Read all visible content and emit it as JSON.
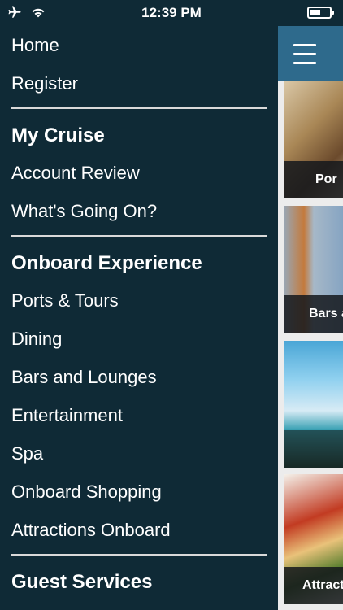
{
  "status_bar": {
    "time": "12:39 PM",
    "battery_level": 0.45
  },
  "menu": {
    "home": "Home",
    "register": "Register",
    "my_cruise": {
      "heading": "My Cruise",
      "items": [
        "Account Review",
        "What's Going On?"
      ]
    },
    "onboard_experience": {
      "heading": "Onboard Experience",
      "items": [
        "Ports & Tours",
        "Dining",
        "Bars and Lounges",
        "Entertainment",
        "Spa",
        "Onboard Shopping",
        "Attractions Onboard"
      ]
    },
    "guest_services": {
      "heading": "Guest Services"
    }
  },
  "content": {
    "cards": [
      {
        "label": "Por"
      },
      {
        "label": "Bars a"
      },
      {
        "label": ""
      },
      {
        "label": "Attract"
      }
    ]
  },
  "icons": {
    "airplane": "airplane-icon",
    "wifi": "wifi-icon",
    "battery": "battery-icon",
    "menu": "hamburger-menu-icon"
  }
}
